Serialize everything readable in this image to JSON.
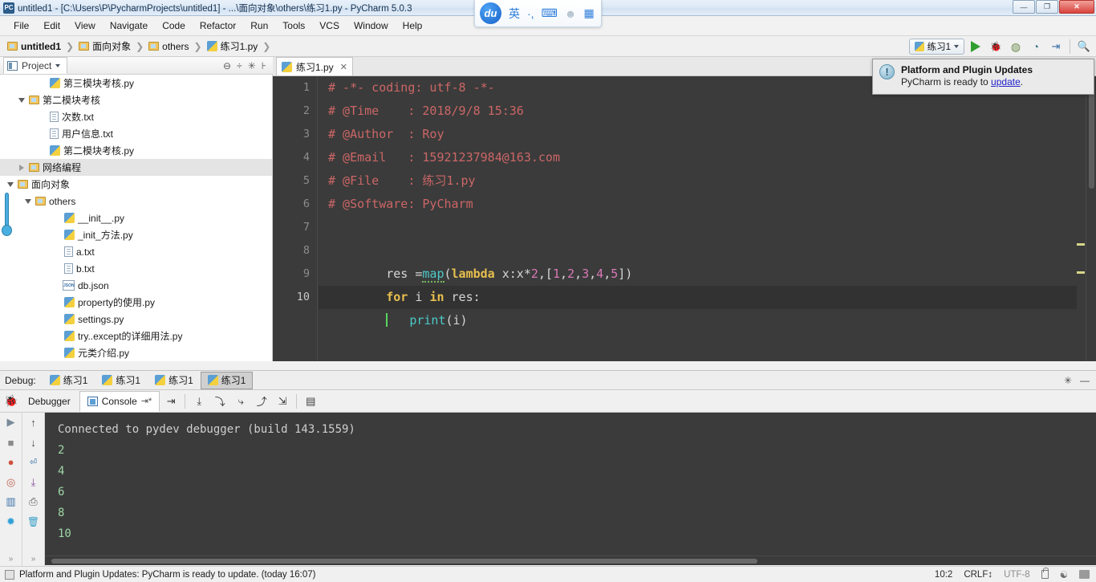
{
  "window": {
    "title": "untitled1 - [C:\\Users\\P\\PycharmProjects\\untitled1] - ...\\面向对象\\others\\练习1.py - PyCharm 5.0.3",
    "app_icon": "PC",
    "minimize": "—",
    "maximize": "❐",
    "close": "✕"
  },
  "menubar": {
    "items": [
      {
        "label": "File"
      },
      {
        "label": "Edit"
      },
      {
        "label": "View"
      },
      {
        "label": "Navigate"
      },
      {
        "label": "Code"
      },
      {
        "label": "Refactor"
      },
      {
        "label": "Run"
      },
      {
        "label": "Tools"
      },
      {
        "label": "VCS"
      },
      {
        "label": "Window"
      },
      {
        "label": "Help"
      }
    ]
  },
  "ime": {
    "logo": "du",
    "mode": "英",
    "punct": "·,",
    "keyboard": "⌨",
    "user": "☻",
    "apps": "▦"
  },
  "breadcrumb": {
    "items": [
      {
        "label": "untitled1",
        "icon": "folder-icon"
      },
      {
        "label": "面向对象",
        "icon": "folder-icon"
      },
      {
        "label": "others",
        "icon": "folder-icon"
      },
      {
        "label": "练习1.py",
        "icon": "python-file-icon"
      }
    ],
    "separator": "❯"
  },
  "toolbar": {
    "run_config": "练习1",
    "buttons": [
      {
        "name": "run-button",
        "glyph": "▶"
      },
      {
        "name": "debug-button",
        "glyph": "🐞"
      },
      {
        "name": "coverage-button",
        "glyph": "◍"
      },
      {
        "name": "profile-button",
        "glyph": "◔"
      },
      {
        "name": "attach-button",
        "glyph": "⇥"
      },
      {
        "name": "search-button",
        "glyph": "🔍"
      }
    ]
  },
  "project_panel": {
    "tab_label": "Project",
    "header_icons": [
      "collapse-all-icon",
      "expand-all-icon",
      "settings-icon",
      "hide-icon"
    ],
    "tree": [
      {
        "label": "第三模块考核.py",
        "icon": "python-file-icon",
        "indent": 4,
        "twisty": "none",
        "selected": false
      },
      {
        "label": "第二模块考核",
        "icon": "folder-icon",
        "indent": 2,
        "twisty": "down",
        "selected": false
      },
      {
        "label": "次数.txt",
        "icon": "text-file-icon",
        "indent": 4,
        "twisty": "none",
        "selected": false
      },
      {
        "label": "用户信息.txt",
        "icon": "text-file-icon",
        "indent": 4,
        "twisty": "none",
        "selected": false
      },
      {
        "label": "第二模块考核.py",
        "icon": "python-file-icon",
        "indent": 4,
        "twisty": "none",
        "selected": false
      },
      {
        "label": "网络编程",
        "icon": "folder-icon",
        "indent": 2,
        "twisty": "right",
        "selected": true
      },
      {
        "label": "面向对象",
        "icon": "folder-icon",
        "indent": 1,
        "twisty": "down",
        "selected": false
      },
      {
        "label": "others",
        "icon": "folder-icon",
        "indent": 3,
        "twisty": "down",
        "selected": false
      },
      {
        "label": "__init__.py",
        "icon": "python-file-icon",
        "indent": 5,
        "twisty": "none",
        "selected": false
      },
      {
        "label": "_init_方法.py",
        "icon": "python-file-icon",
        "indent": 5,
        "twisty": "none",
        "selected": false
      },
      {
        "label": "a.txt",
        "icon": "text-file-icon",
        "indent": 5,
        "twisty": "none",
        "selected": false
      },
      {
        "label": "b.txt",
        "icon": "text-file-icon",
        "indent": 5,
        "twisty": "none",
        "selected": false
      },
      {
        "label": "db.json",
        "icon": "json-file-icon",
        "indent": 5,
        "twisty": "none",
        "selected": false
      },
      {
        "label": "property的使用.py",
        "icon": "python-file-icon",
        "indent": 5,
        "twisty": "none",
        "selected": false
      },
      {
        "label": "settings.py",
        "icon": "python-file-icon",
        "indent": 5,
        "twisty": "none",
        "selected": false
      },
      {
        "label": "try..except的详细用法.py",
        "icon": "python-file-icon",
        "indent": 5,
        "twisty": "none",
        "selected": false
      },
      {
        "label": "元类介绍.py",
        "icon": "python-file-icon",
        "indent": 5,
        "twisty": "none",
        "selected": false
      }
    ]
  },
  "editor": {
    "tab": {
      "label": "练习1.py",
      "close": "✕"
    },
    "line_numbers": [
      "1",
      "2",
      "3",
      "4",
      "5",
      "6",
      "7",
      "8",
      "9",
      "10"
    ],
    "current_line": 10,
    "lines": [
      {
        "n": "1",
        "text": "# -*- coding: utf-8 -*-"
      },
      {
        "n": "2",
        "text": "# @Time    : 2018/9/8 15:36"
      },
      {
        "n": "3",
        "text": "# @Author  : Roy"
      },
      {
        "n": "4",
        "text": "# @Email   : 15921237984@163.com"
      },
      {
        "n": "5",
        "text": "# @File    : 练习1.py"
      },
      {
        "n": "6",
        "text": "# @Software: PyCharm"
      },
      {
        "n": "7",
        "text": ""
      },
      {
        "n": "8",
        "text": "res =map(lambda x:x*2,[1,2,3,4,5])"
      },
      {
        "n": "9",
        "text": "for i in res:"
      },
      {
        "n": "10",
        "text": "    print(i)"
      }
    ]
  },
  "notification": {
    "title": "Platform and Plugin Updates",
    "body_prefix": "PyCharm is ready to ",
    "link": "update",
    "body_suffix": ".",
    "icon": "info-icon"
  },
  "debug_panel": {
    "label": "Debug:",
    "tabs": [
      {
        "label": "练习1",
        "selected": false
      },
      {
        "label": "练习1",
        "selected": false
      },
      {
        "label": "练习1",
        "selected": false
      },
      {
        "label": "练习1",
        "selected": true
      }
    ],
    "settings_icon": "gear-icon",
    "hide_icon": "minimize-icon",
    "subtabs": [
      {
        "label": "Debugger",
        "selected": false,
        "icon": "debugger-icon"
      },
      {
        "label": "Console",
        "selected": true,
        "icon": "console-icon"
      }
    ],
    "step_buttons": [
      {
        "name": "show-execution-point-button",
        "glyph": "⇥"
      },
      {
        "name": "step-over-button",
        "glyph": "⤓"
      },
      {
        "name": "step-into-button",
        "glyph": "⤵"
      },
      {
        "name": "force-step-into-button",
        "glyph": "⤷"
      },
      {
        "name": "step-out-button",
        "glyph": "⤴"
      },
      {
        "name": "run-to-cursor-button",
        "glyph": "⇲"
      },
      {
        "name": "evaluate-expression-button",
        "glyph": "▤"
      }
    ],
    "left_toolbar": [
      {
        "name": "resume-program-button",
        "glyph": "▶"
      },
      {
        "name": "stop-button",
        "glyph": "■"
      },
      {
        "name": "view-breakpoints-button",
        "glyph": "●"
      },
      {
        "name": "mute-breakpoints-button",
        "glyph": "◎"
      },
      {
        "name": "restore-layout-button",
        "glyph": "▥"
      },
      {
        "name": "settings-button",
        "glyph": "✹"
      },
      {
        "name": "expand-toolbar-button",
        "glyph": "»"
      }
    ],
    "left_toolbar2": [
      {
        "name": "up-the-stack-button",
        "glyph": "↑"
      },
      {
        "name": "down-the-stack-button",
        "glyph": "↓"
      },
      {
        "name": "soft-wrap-button",
        "glyph": "⏎"
      },
      {
        "name": "scroll-to-end-button",
        "glyph": "⤓"
      },
      {
        "name": "print-button",
        "glyph": "⎙"
      },
      {
        "name": "clear-all-button",
        "glyph": "🗑"
      },
      {
        "name": "expand-toolbar-button",
        "glyph": "»"
      }
    ],
    "console_output": [
      {
        "text": "Connected to pydev debugger (build 143.1559)",
        "style": "plain"
      },
      {
        "text": "2",
        "style": "green"
      },
      {
        "text": "4",
        "style": "green"
      },
      {
        "text": "6",
        "style": "green"
      },
      {
        "text": "8",
        "style": "green"
      },
      {
        "text": "10",
        "style": "green"
      }
    ]
  },
  "statusbar": {
    "message": "Platform and Plugin Updates: PyCharm is ready to update. (today 16:07)",
    "caret_position": "10:2",
    "line_separator": "CRLF",
    "encoding": "UTF-8",
    "lock_icon": "lock-icon",
    "inspection_icon": "inspection-icon",
    "memory_icon": "memory-icon"
  },
  "colors": {
    "editor_bg": "#3b3b3b",
    "comment": "#cc6666",
    "keyword": "#e8bf4e",
    "function": "#4ec9c9",
    "number": "#d978b6",
    "plain_text": "#d6d6d6",
    "console_green": "#9fd6a6",
    "accent_blue": "#2e7ddb",
    "run_green": "#2f9e2f"
  }
}
